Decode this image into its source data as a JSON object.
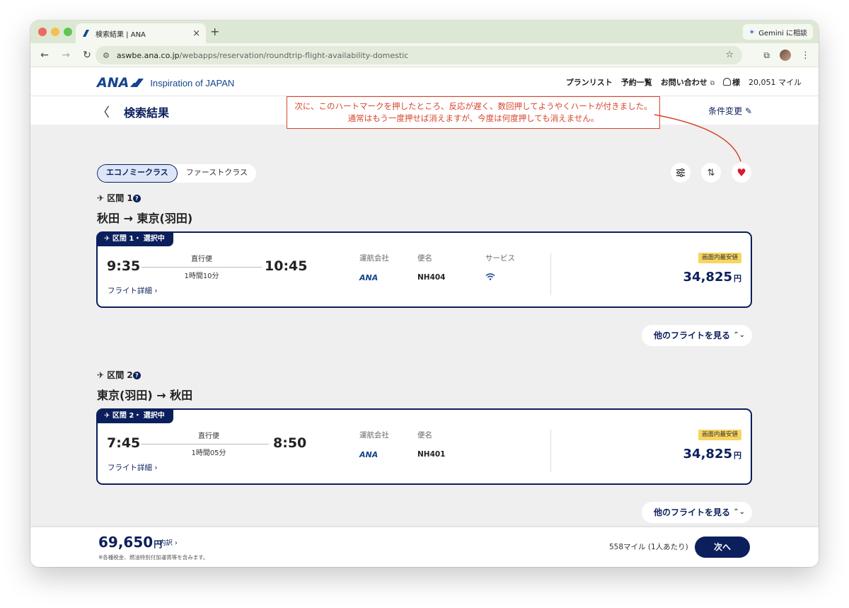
{
  "browser": {
    "tab_title": "検索結果 | ANA",
    "tab_close": "×",
    "new_tab": "+",
    "url_host": "aswbe.ana.co.jp",
    "url_path": "/webapps/reservation/roundtrip-flight-availability-domestic",
    "gemini_label": "Gemini に相談"
  },
  "header": {
    "logo_text": "ANA",
    "tagline": "Inspiration of JAPAN",
    "links": [
      "プランリスト",
      "予約一覧",
      "お問い合わせ"
    ],
    "user_label": "様",
    "miles": "20,051 マイル"
  },
  "results": {
    "title": "検索結果",
    "cond_change": "条件変更"
  },
  "annotation": {
    "line1": "次に、このハートマークを押したところ、反応が遅く、数回押してようやくハートが付きました。",
    "line2": "通常はもう一度押せば消えますが、今度は何度押しても消えません。"
  },
  "class_tabs": [
    "エコノミークラス",
    "ファーストクラス"
  ],
  "icons": {
    "filter": "filter-icon",
    "sort": "sort-icon",
    "heart": "heart-icon"
  },
  "segments": [
    {
      "label": "区間 1",
      "route": "秋田 → 東京(羽田)",
      "tag": "区間 1・ 選択中",
      "depart": "9:35",
      "arrive": "10:45",
      "nonstop": "直行便",
      "duration": "1時間10分",
      "details": "フライト詳細",
      "carrier_label": "運航会社",
      "carrier": "ANA",
      "flight_label": "便名",
      "flight_no": "NH404",
      "service_label": "サービス",
      "has_wifi": true,
      "badge": "画面内最安値",
      "price": "34,825",
      "currency": "円",
      "other_flights": "他のフライトを見る"
    },
    {
      "label": "区間 2",
      "route": "東京(羽田) → 秋田",
      "tag": "区間 2・ 選択中",
      "depart": "7:45",
      "arrive": "8:50",
      "nonstop": "直行便",
      "duration": "1時間05分",
      "details": "フライト詳細",
      "carrier_label": "運航会社",
      "carrier": "ANA",
      "flight_label": "便名",
      "flight_no": "NH401",
      "badge": "画面内最安値",
      "price": "34,825",
      "currency": "円",
      "other_flights": "他のフライトを見る"
    }
  ],
  "footer": {
    "total": "69,650",
    "currency": "円",
    "breakdown": "内訳",
    "tax_note": "※各種税金、燃油特別付加運賃等を含みます。",
    "mile_note": "558マイル (1人あたり)",
    "next": "次へ"
  },
  "colors": {
    "brand": "#0b1f5c",
    "ana_blue": "#13448f",
    "annotation": "#d9442b",
    "heart": "#d81b2f",
    "badge": "#f7d560"
  }
}
